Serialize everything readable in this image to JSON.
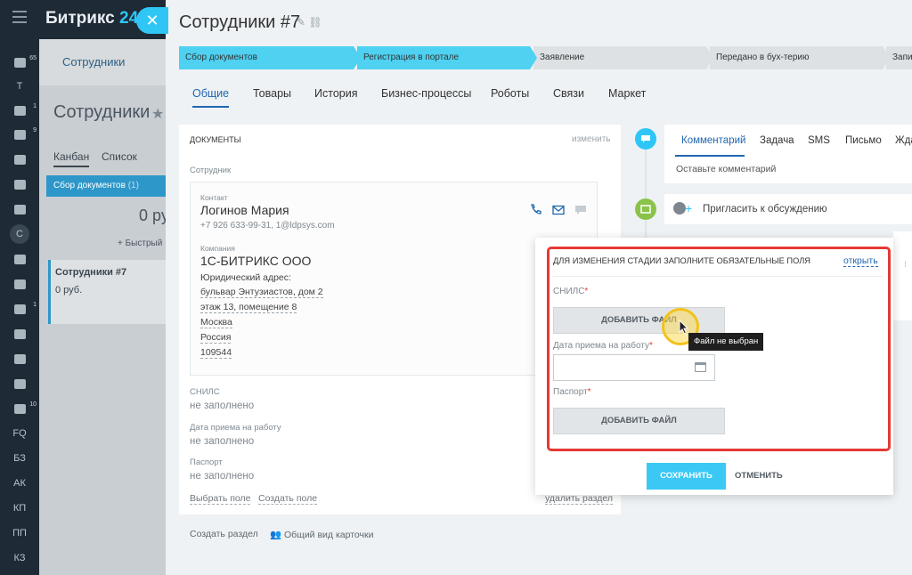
{
  "app": {
    "logo_text": "Битрикс",
    "logo_num": "24"
  },
  "leftbar": {
    "items": [
      {
        "label": "",
        "badge": "65",
        "icon": "filter-icon"
      },
      {
        "label": "Т",
        "badge": "",
        "icon": ""
      },
      {
        "label": "",
        "badge": "1",
        "icon": "news-icon"
      },
      {
        "label": "",
        "badge": "9",
        "icon": "tasks-icon"
      },
      {
        "label": "",
        "badge": "",
        "icon": "chat-icon"
      },
      {
        "label": "",
        "badge": "",
        "icon": "users-icon"
      },
      {
        "label": "",
        "badge": "",
        "icon": "drive-icon"
      },
      {
        "label": "С",
        "badge": "",
        "icon": ""
      },
      {
        "label": "",
        "badge": "",
        "icon": "calendar-icon"
      },
      {
        "label": "",
        "badge": "",
        "icon": "clock-icon"
      },
      {
        "label": "",
        "badge": "1",
        "icon": "mail-icon"
      },
      {
        "label": "",
        "badge": "",
        "icon": "bot-icon"
      },
      {
        "label": "",
        "badge": "",
        "icon": "window-icon"
      },
      {
        "label": "",
        "badge": "",
        "icon": "contact-icon"
      },
      {
        "label": "",
        "badge": "10",
        "icon": "cart-icon"
      },
      {
        "label": "FQ",
        "badge": "",
        "icon": ""
      },
      {
        "label": "БЗ",
        "badge": "",
        "icon": ""
      },
      {
        "label": "АК",
        "badge": "",
        "icon": ""
      },
      {
        "label": "КП",
        "badge": "",
        "icon": ""
      },
      {
        "label": "ПП",
        "badge": "",
        "icon": ""
      },
      {
        "label": "КЗ",
        "badge": "",
        "icon": ""
      }
    ]
  },
  "background": {
    "tab": "Сотрудники",
    "title": "Сотрудники",
    "kanban": "Канбан",
    "list": "Список",
    "stage": "Сбор документов",
    "stage_count": "(1)",
    "sum": "0 ру",
    "quick_add": "+ Быстрый",
    "card_title": "Сотрудники #7",
    "card_sum": "0 руб."
  },
  "slider": {
    "title": "Сотрудники #7",
    "stages": [
      {
        "label": "Сбор документов",
        "state": "done"
      },
      {
        "label": "Регистрация в портале",
        "state": "done"
      },
      {
        "label": "Заявление",
        "state": "todo"
      },
      {
        "label": "Передано в бух-терию",
        "state": "todo"
      },
      {
        "label": "Запи",
        "state": "todo"
      }
    ],
    "tabs": [
      "Общие",
      "Товары",
      "История",
      "Бизнес-процессы",
      "Роботы",
      "Связи",
      "Маркет"
    ],
    "documents": {
      "header": "ДОКУМЕНТЫ",
      "change": "изменить",
      "employee_label": "Сотрудник",
      "contact_label": "Контакт",
      "contact_name": "Логинов Мария",
      "contact_info": "+7 926 633-99-31, 1@ldpsys.com",
      "company_label": "Компания",
      "company_name": "1С-БИТРИКС ООО",
      "legal_address_label": "Юридический адрес:",
      "address_lines": [
        "бульвар Энтузиастов, дом 2",
        "этаж 13, помещение 8",
        "Москва",
        "Россия",
        "109544"
      ],
      "snils_label": "СНИЛС",
      "snils_value": "не заполнено",
      "hire_date_label": "Дата приема на работу",
      "hire_date_value": "не заполнено",
      "passport_label": "Паспорт",
      "passport_value": "не заполнено",
      "select_field": "Выбрать поле",
      "create_field": "Создать поле",
      "delete_section": "удалить раздел",
      "create_section": "Создать раздел",
      "card_view": "Общий вид карточки"
    },
    "activity": {
      "tabs": [
        "Комментарий",
        "Задача",
        "SMS",
        "Письмо",
        "Жда"
      ],
      "comment_placeholder": "Оставьте комментарий",
      "invite": "Пригласить к обсуждению"
    },
    "popup": {
      "title": "ДЛЯ ИЗМЕНЕНИЯ СТАДИИ ЗАПОЛНИТЕ ОБЯЗАТЕЛЬНЫЕ ПОЛЯ",
      "open": "открыть",
      "snils_label": "СНИЛС",
      "add_file": "ДОБАВИТЬ ФАЙЛ",
      "tooltip": "Файл не выбран",
      "hire_label": "Дата приема на работу",
      "passport_label": "Паспорт",
      "required_mark": "*",
      "save": "СОХРАНИТЬ",
      "cancel": "ОТМЕНИТЬ"
    }
  },
  "colors": {
    "accent": "#2fc6f6",
    "stage_done": "#4fd1f1",
    "highlight": "#e53935",
    "link": "#2067b0"
  }
}
